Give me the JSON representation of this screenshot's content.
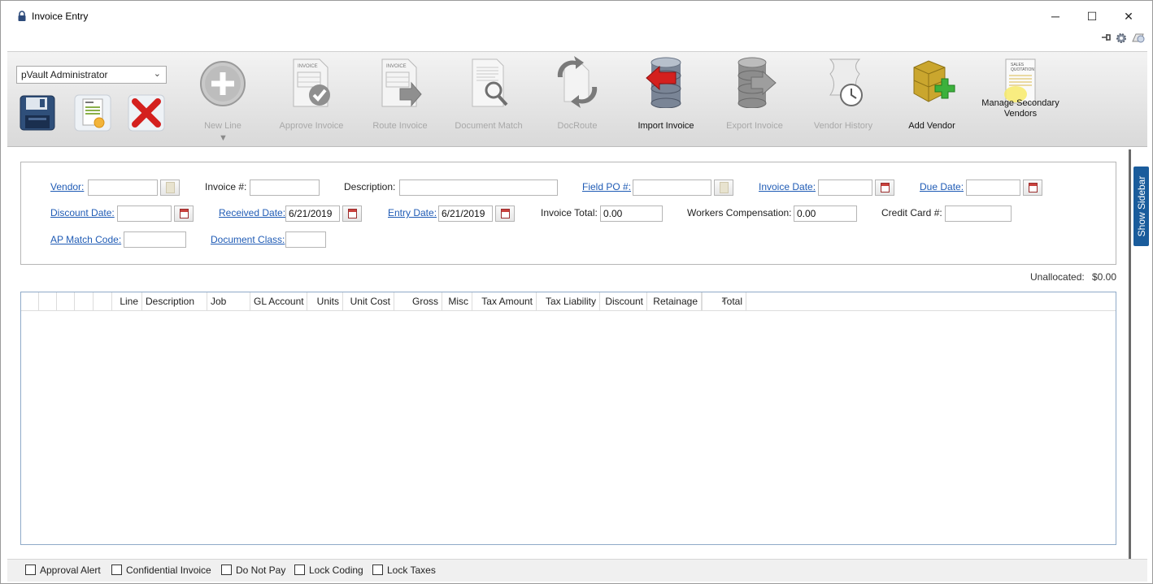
{
  "window": {
    "title": "Invoice Entry",
    "controls": {
      "minimize": "─",
      "maximize": "☐",
      "close": "✕"
    }
  },
  "toolbar": {
    "user_select": "pVault Administrator",
    "buttons": [
      {
        "label": "New Line",
        "enabled": false,
        "icon": "plus-circle-icon"
      },
      {
        "label": "Approve Invoice",
        "enabled": false,
        "icon": "invoice-check-icon"
      },
      {
        "label": "Route Invoice",
        "enabled": false,
        "icon": "invoice-arrow-icon"
      },
      {
        "label": "Document Match",
        "enabled": false,
        "icon": "document-magnify-icon"
      },
      {
        "label": "DocRoute",
        "enabled": false,
        "icon": "docroute-icon"
      },
      {
        "label": "Import Invoice",
        "enabled": true,
        "icon": "database-import-icon"
      },
      {
        "label": "Export Invoice",
        "enabled": false,
        "icon": "database-export-icon"
      },
      {
        "label": "Vendor History",
        "enabled": false,
        "icon": "scroll-clock-icon"
      },
      {
        "label": "Add Vendor",
        "enabled": true,
        "icon": "boxes-plus-icon"
      },
      {
        "label": "Manage Secondary Vendors",
        "enabled": true,
        "icon": "sales-quotation-icon"
      }
    ],
    "doc_thumbnail_labels": {
      "invoice": "INVOICE",
      "sales": "SALES",
      "quotation": "QUOTATION"
    }
  },
  "form": {
    "vendor_label": "Vendor:",
    "vendor_value": "",
    "invoice_no_label": "Invoice #:",
    "invoice_no_value": "",
    "description_label": "Description:",
    "description_value": "",
    "field_po_label": "Field PO #:",
    "field_po_value": "",
    "invoice_date_label": "Invoice Date:",
    "invoice_date_value": "",
    "due_date_label": "Due Date:",
    "due_date_value": "",
    "discount_date_label": "Discount Date:",
    "discount_date_value": "",
    "received_date_label": "Received Date:",
    "received_date_value": "6/21/2019",
    "entry_date_label": "Entry Date:",
    "entry_date_value": "6/21/2019",
    "invoice_total_label": "Invoice Total:",
    "invoice_total_value": "0.00",
    "workers_comp_label": "Workers Compensation:",
    "workers_comp_value": "0.00",
    "credit_card_label": "Credit Card #:",
    "credit_card_value": "",
    "ap_match_label": "AP Match Code:",
    "ap_match_value": "",
    "doc_class_label": "Document Class:",
    "doc_class_value": ""
  },
  "unallocated": {
    "label": "Unallocated:",
    "value": "$0.00"
  },
  "grid": {
    "columns": [
      "Line",
      "Description",
      "Job",
      "GL Account",
      "Units",
      "Unit Cost",
      "Gross",
      "Misc",
      "Tax Amount",
      "Tax Liability",
      "Discount",
      "Retainage",
      "Total"
    ],
    "sorted_indicator": "▲",
    "rows": []
  },
  "sidebar": {
    "label": "Show Sidebar"
  },
  "footer": {
    "checkboxes": [
      {
        "label": "Approval Alert",
        "checked": false
      },
      {
        "label": "Confidential Invoice",
        "checked": false
      },
      {
        "label": "Do Not Pay",
        "checked": false
      },
      {
        "label": "Lock Coding",
        "checked": false
      },
      {
        "label": "Lock Taxes",
        "checked": false
      }
    ]
  },
  "colors": {
    "link": "#1f5bb5",
    "sidebar_tab": "#1a5c9c",
    "disabled_text": "#a8a8a8"
  }
}
